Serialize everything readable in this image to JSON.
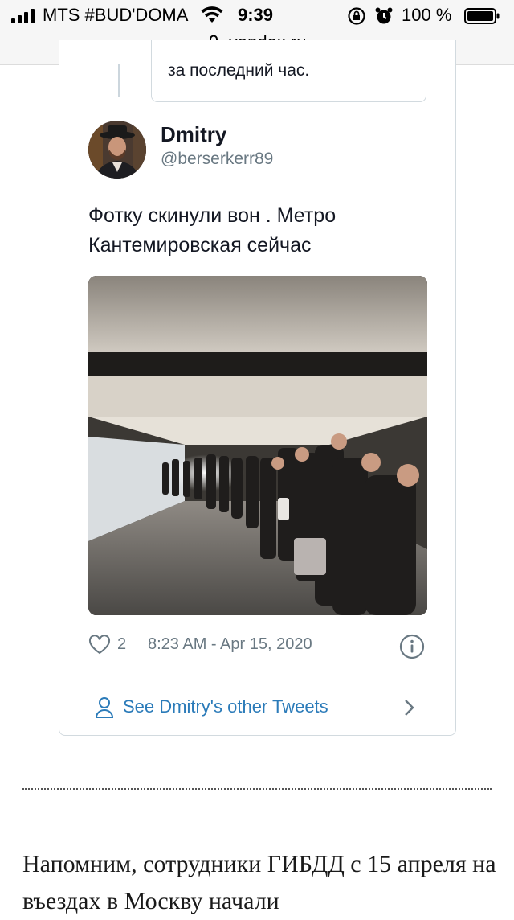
{
  "status_bar": {
    "carrier": "MTS #BUD'DOMA",
    "time": "9:39",
    "battery": "100 %",
    "url": "yandex.ru",
    "icons": [
      "signal-icon",
      "wifi-icon",
      "orientation-lock-icon",
      "alarm-icon",
      "battery-icon",
      "lock-icon"
    ]
  },
  "quoted_tweet": {
    "text_tail": "за последний час."
  },
  "tweet": {
    "display_name": "Dmitry",
    "username": "@berserkerr89",
    "text": "Фотку скинули вон . Метро Кантемировская сейчас",
    "photo_description": "people-queue-in-metro-underpass",
    "likes": "2",
    "timestamp": "8:23 AM - Apr 15, 2020",
    "see_more_label": "See Dmitry's other Tweets",
    "link_color": "#2b7bb9"
  },
  "article": {
    "text": "Напомним, сотрудники ГИБДД с 15 апреля на въездах в Москву начали"
  }
}
